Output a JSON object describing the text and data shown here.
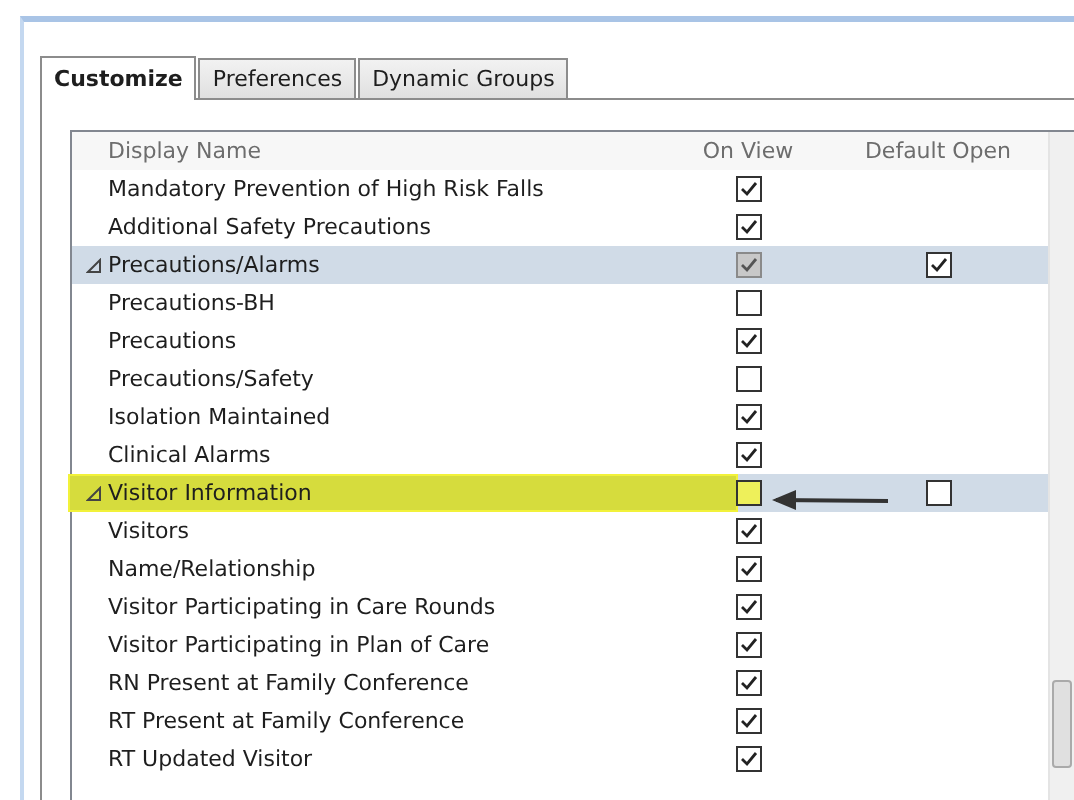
{
  "tabs": [
    {
      "label": "Customize",
      "selected": true
    },
    {
      "label": "Preferences",
      "selected": false
    },
    {
      "label": "Dynamic Groups",
      "selected": false
    }
  ],
  "columns": [
    "Display Name",
    "On View",
    "Default Open"
  ],
  "rows": [
    {
      "kind": "item",
      "name": "Mandatory Prevention of High Risk Falls",
      "on_view": true,
      "on_view_disabled": false,
      "highlighted": false,
      "arrow": false
    },
    {
      "kind": "item",
      "name": "Additional Safety Precautions",
      "on_view": true,
      "on_view_disabled": false,
      "highlighted": false,
      "arrow": false
    },
    {
      "kind": "group",
      "name": "Precautions/Alarms",
      "expanded": true,
      "on_view": true,
      "on_view_disabled": true,
      "default_open": true,
      "highlighted": false,
      "arrow": false
    },
    {
      "kind": "item",
      "name": "Precautions-BH",
      "on_view": false,
      "on_view_disabled": false,
      "highlighted": false,
      "arrow": false
    },
    {
      "kind": "item",
      "name": "Precautions",
      "on_view": true,
      "on_view_disabled": false,
      "highlighted": false,
      "arrow": false
    },
    {
      "kind": "item",
      "name": "Precautions/Safety",
      "on_view": false,
      "on_view_disabled": false,
      "highlighted": false,
      "arrow": false
    },
    {
      "kind": "item",
      "name": "Isolation Maintained",
      "on_view": true,
      "on_view_disabled": false,
      "highlighted": false,
      "arrow": false
    },
    {
      "kind": "item",
      "name": "Clinical Alarms",
      "on_view": true,
      "on_view_disabled": false,
      "highlighted": false,
      "arrow": false
    },
    {
      "kind": "group",
      "name": "Visitor Information",
      "expanded": true,
      "on_view": false,
      "on_view_disabled": false,
      "default_open": false,
      "highlighted": true,
      "arrow": true
    },
    {
      "kind": "item",
      "name": "Visitors",
      "on_view": true,
      "on_view_disabled": false,
      "highlighted": false,
      "arrow": false
    },
    {
      "kind": "item",
      "name": "Name/Relationship",
      "on_view": true,
      "on_view_disabled": false,
      "highlighted": false,
      "arrow": false
    },
    {
      "kind": "item",
      "name": "Visitor Participating in Care Rounds",
      "on_view": true,
      "on_view_disabled": false,
      "highlighted": false,
      "arrow": false
    },
    {
      "kind": "item",
      "name": "Visitor Participating in Plan of Care",
      "on_view": true,
      "on_view_disabled": false,
      "highlighted": false,
      "arrow": false
    },
    {
      "kind": "item",
      "name": "RN Present at Family Conference",
      "on_view": true,
      "on_view_disabled": false,
      "highlighted": false,
      "arrow": false
    },
    {
      "kind": "item",
      "name": "RT Present at Family Conference",
      "on_view": true,
      "on_view_disabled": false,
      "highlighted": false,
      "arrow": false
    },
    {
      "kind": "item",
      "name": "RT Updated Visitor",
      "on_view": true,
      "on_view_disabled": false,
      "highlighted": false,
      "arrow": false
    }
  ]
}
